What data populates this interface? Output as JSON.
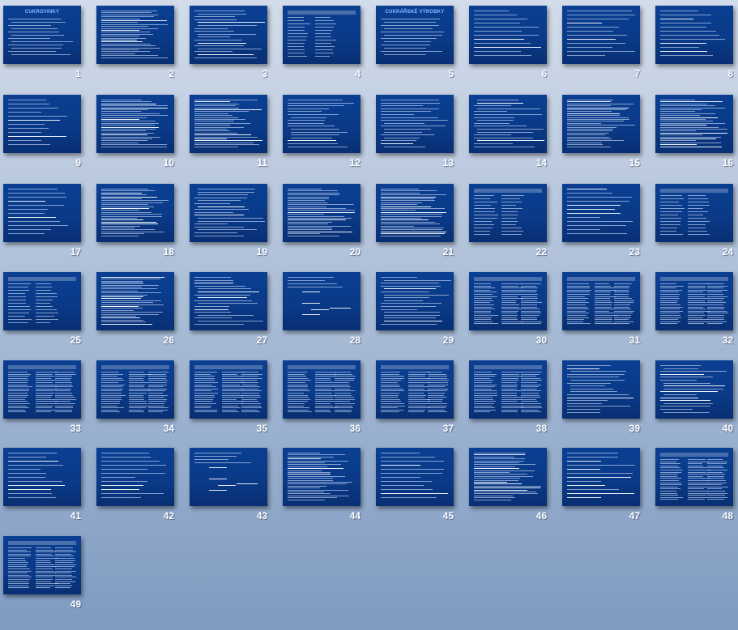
{
  "view": "slide-sorter",
  "accent_color": "#0a3a88",
  "slides": [
    {
      "number": "1",
      "title": "CUKROVINKY",
      "layout": "title-text"
    },
    {
      "number": "2",
      "layout": "dense-text"
    },
    {
      "number": "3",
      "layout": "bullets"
    },
    {
      "number": "4",
      "layout": "table"
    },
    {
      "number": "5",
      "title": "CUKRÁŘSKÉ VÝROBKY",
      "layout": "title-text"
    },
    {
      "number": "6",
      "layout": "text"
    },
    {
      "number": "7",
      "layout": "text"
    },
    {
      "number": "8",
      "layout": "text"
    },
    {
      "number": "9",
      "layout": "text"
    },
    {
      "number": "10",
      "layout": "dense-text"
    },
    {
      "number": "11",
      "layout": "dense-text"
    },
    {
      "number": "12",
      "layout": "bullets"
    },
    {
      "number": "13",
      "layout": "bullets"
    },
    {
      "number": "14",
      "layout": "bullets"
    },
    {
      "number": "15",
      "layout": "dense-text"
    },
    {
      "number": "16",
      "layout": "dense-text"
    },
    {
      "number": "17",
      "layout": "text"
    },
    {
      "number": "18",
      "layout": "dense-text"
    },
    {
      "number": "19",
      "layout": "bullets"
    },
    {
      "number": "20",
      "layout": "dense-text"
    },
    {
      "number": "21",
      "layout": "dense-text"
    },
    {
      "number": "22",
      "layout": "table"
    },
    {
      "number": "23",
      "layout": "text"
    },
    {
      "number": "24",
      "layout": "table"
    },
    {
      "number": "25",
      "layout": "table"
    },
    {
      "number": "26",
      "layout": "dense-text"
    },
    {
      "number": "27",
      "layout": "bullets"
    },
    {
      "number": "28",
      "layout": "diagram"
    },
    {
      "number": "29",
      "layout": "bullets"
    },
    {
      "number": "30",
      "layout": "dense-table"
    },
    {
      "number": "31",
      "layout": "dense-table"
    },
    {
      "number": "32",
      "layout": "dense-table"
    },
    {
      "number": "33",
      "layout": "dense-table"
    },
    {
      "number": "34",
      "layout": "dense-table"
    },
    {
      "number": "35",
      "layout": "dense-table"
    },
    {
      "number": "36",
      "layout": "dense-table"
    },
    {
      "number": "37",
      "layout": "dense-table"
    },
    {
      "number": "38",
      "layout": "dense-table"
    },
    {
      "number": "39",
      "layout": "bullets"
    },
    {
      "number": "40",
      "layout": "bullets"
    },
    {
      "number": "41",
      "layout": "text"
    },
    {
      "number": "42",
      "layout": "text"
    },
    {
      "number": "43",
      "layout": "diagram"
    },
    {
      "number": "44",
      "layout": "dense-text"
    },
    {
      "number": "45",
      "layout": "text"
    },
    {
      "number": "46",
      "layout": "dense-text"
    },
    {
      "number": "47",
      "layout": "text"
    },
    {
      "number": "48",
      "layout": "dense-table"
    },
    {
      "number": "49",
      "layout": "dense-table"
    }
  ]
}
